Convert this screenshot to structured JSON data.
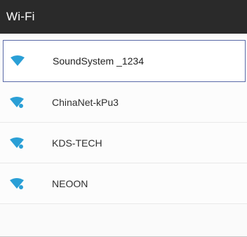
{
  "app": {
    "title": "Wi-Fi"
  },
  "networks": [
    {
      "ssid": "SoundSystem _1234",
      "selected": true,
      "icon": "wifi-strong-icon"
    },
    {
      "ssid": "ChinaNet-kPu3",
      "selected": false,
      "icon": "wifi-secured-icon"
    },
    {
      "ssid": "KDS-TECH",
      "selected": false,
      "icon": "wifi-secured-icon"
    },
    {
      "ssid": "NEOON",
      "selected": false,
      "icon": "wifi-secured-icon"
    }
  ],
  "colors": {
    "titlebar": "#2a2a2a",
    "wifi_icon": "#2a9fd6",
    "selection_border": "#5a6aa8"
  }
}
